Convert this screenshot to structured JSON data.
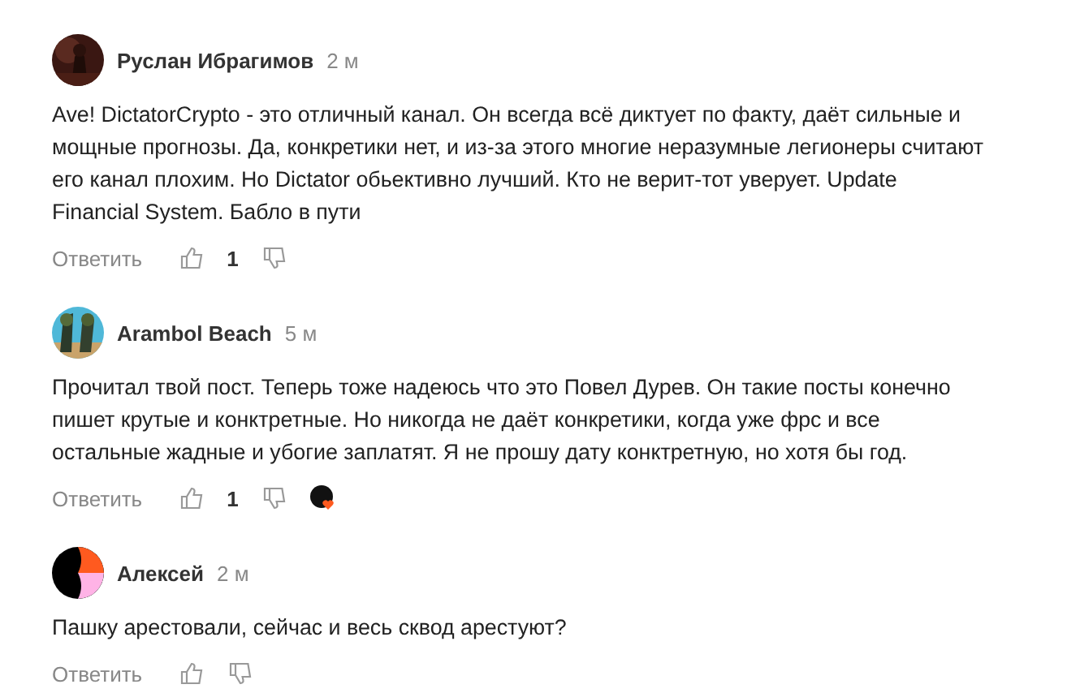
{
  "comments": [
    {
      "author": "Руслан Ибрагимов",
      "time": "2 м",
      "text": "Ave! DictatorCrypto - это отличный канал. Он всегда всё диктует по факту, даёт сильные и мощные прогнозы. Да, конкретики нет, и из-за этого многие неразумные легионеры считают его канал плохим. Но Dictator обьективно лучший. Кто не верит-тот уверует. Update Financial System. Бабло в пути",
      "reply": "Ответить",
      "likes": "1",
      "liked_by_author": false
    },
    {
      "author": "Arambol Beach",
      "time": "5 м",
      "text": "Прочитал твой пост. Теперь тоже надеюсь что это Повел Дурев. Он такие посты конечно пишет крутые и конктретные. Но никогда не даёт конкретики, когда уже фрс и все остальные жадные и убогие заплатят. Я не прошу дату конктретную, но хотя бы год.",
      "reply": "Ответить",
      "likes": "1",
      "liked_by_author": true
    },
    {
      "author": "Алексей",
      "time": "2 м",
      "avatar": {
        "kind": "logo"
      },
      "text": "Пашку арестовали, сейчас и весь сквод арестуют?",
      "reply": "Ответить",
      "liked_by_author": false
    }
  ]
}
